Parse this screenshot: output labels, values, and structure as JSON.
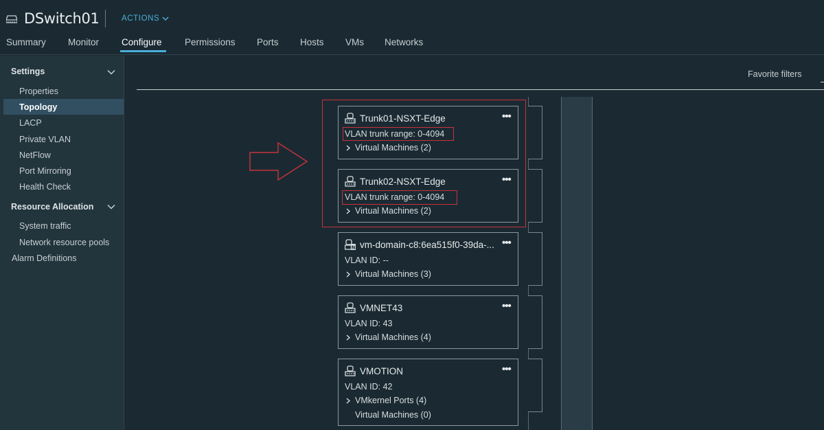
{
  "header": {
    "title": "DSwitch01",
    "actions_label": "ACTIONS",
    "tabs": [
      {
        "label": "Summary"
      },
      {
        "label": "Monitor"
      },
      {
        "label": "Configure"
      },
      {
        "label": "Permissions"
      },
      {
        "label": "Ports"
      },
      {
        "label": "Hosts"
      },
      {
        "label": "VMs"
      },
      {
        "label": "Networks"
      }
    ],
    "active_tab": "Configure"
  },
  "sidebar": {
    "sections": [
      {
        "label": "Settings",
        "items": [
          "Properties",
          "Topology",
          "LACP",
          "Private VLAN",
          "NetFlow",
          "Port Mirroring",
          "Health Check"
        ]
      },
      {
        "label": "Resource Allocation",
        "items": [
          "System traffic",
          "Network resource pools"
        ]
      }
    ],
    "root_item": "Alarm Definitions",
    "selected": "Topology"
  },
  "main": {
    "favorite_filters": "Favorite filters"
  },
  "topology": {
    "portgroups": [
      {
        "name": "Trunk01-NSXT-Edge",
        "vlan": "VLAN trunk range: 0-4094",
        "rows": [
          "Virtual Machines (2)"
        ],
        "icon": "portgroup-icon",
        "highlighted": true
      },
      {
        "name": "Trunk02-NSXT-Edge",
        "vlan": "VLAN trunk range: 0-4094",
        "rows": [
          "Virtual Machines (2)"
        ],
        "icon": "portgroup-icon",
        "highlighted": true
      },
      {
        "name": "vm-domain-c8:6ea515f0-39da-...",
        "vlan": "VLAN ID: --",
        "rows": [
          "Virtual Machines (3)"
        ],
        "icon": "nsx-portgroup-icon",
        "highlighted": false
      },
      {
        "name": "VMNET43",
        "vlan": "VLAN ID: 43",
        "rows": [
          "Virtual Machines (4)"
        ],
        "icon": "portgroup-icon",
        "highlighted": false
      },
      {
        "name": "VMOTION",
        "vlan": "VLAN ID: 42",
        "rows": [
          "VMkernel Ports (4)",
          "Virtual Machines (0)"
        ],
        "icon": "portgroup-icon",
        "highlighted": false
      }
    ]
  },
  "colors": {
    "background": "#1b2a32",
    "sidebar": "#22343c",
    "accent": "#49afd9",
    "highlight": "#c8323c",
    "selected": "#324f61"
  }
}
